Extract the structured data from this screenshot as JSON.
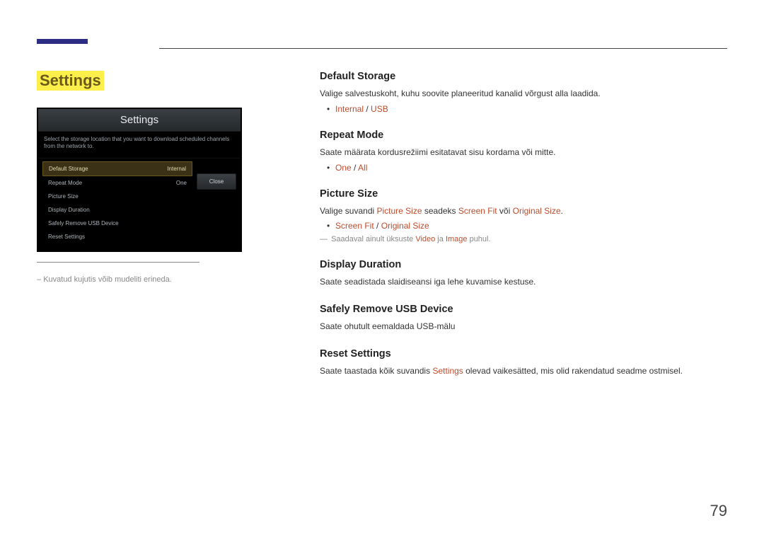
{
  "pageTitle": "Settings",
  "osd": {
    "title": "Settings",
    "hint": "Select the storage location that you want to download scheduled channels from the network to.",
    "rows": [
      {
        "label": "Default Storage",
        "value": "Internal",
        "selected": true
      },
      {
        "label": "Repeat Mode",
        "value": "One"
      },
      {
        "label": "Picture Size",
        "value": ""
      },
      {
        "label": "Display Duration",
        "value": ""
      },
      {
        "label": "Safely Remove USB Device",
        "value": ""
      },
      {
        "label": "Reset Settings",
        "value": ""
      }
    ],
    "button": "Close"
  },
  "caption": {
    "dash": "–",
    "text": "Kuvatud kujutis võib mudeliti erineda."
  },
  "sections": {
    "defaultStorage": {
      "heading": "Default Storage",
      "desc": "Valige salvestuskoht, kuhu soovite planeeritud kanalid võrgust alla laadida.",
      "opt1": "Internal",
      "slash": " / ",
      "opt2": "USB"
    },
    "repeatMode": {
      "heading": "Repeat Mode",
      "desc": "Saate määrata kordusrežiimi esitatavat sisu kordama või mitte.",
      "opt1": "One",
      "slash": " / ",
      "opt2": "All"
    },
    "pictureSize": {
      "heading": "Picture Size",
      "descPre": "Valige suvandi ",
      "descT1": "Picture Size",
      "descMid1": " seadeks ",
      "descT2": "Screen Fit",
      "descMid2": " või ",
      "descT3": "Original Size",
      "descEnd": ".",
      "opt1": "Screen Fit",
      "slash": " / ",
      "opt2": "Original Size",
      "noteDash": "―",
      "notePre": "Saadaval ainult üksuste ",
      "noteT1": "Video",
      "noteMid": " ja ",
      "noteT2": "Image",
      "noteEnd": " puhul."
    },
    "displayDuration": {
      "heading": "Display Duration",
      "desc": "Saate seadistada slaidiseansi iga lehe kuvamise kestuse."
    },
    "safelyRemove": {
      "heading": "Safely Remove USB Device",
      "desc": "Saate ohutult eemaldada USB-mälu"
    },
    "resetSettings": {
      "heading": "Reset Settings",
      "descPre": "Saate taastada kõik suvandis ",
      "descT1": "Settings",
      "descEnd": " olevad vaikesätted, mis olid rakendatud seadme ostmisel."
    }
  },
  "pageNumber": "79"
}
